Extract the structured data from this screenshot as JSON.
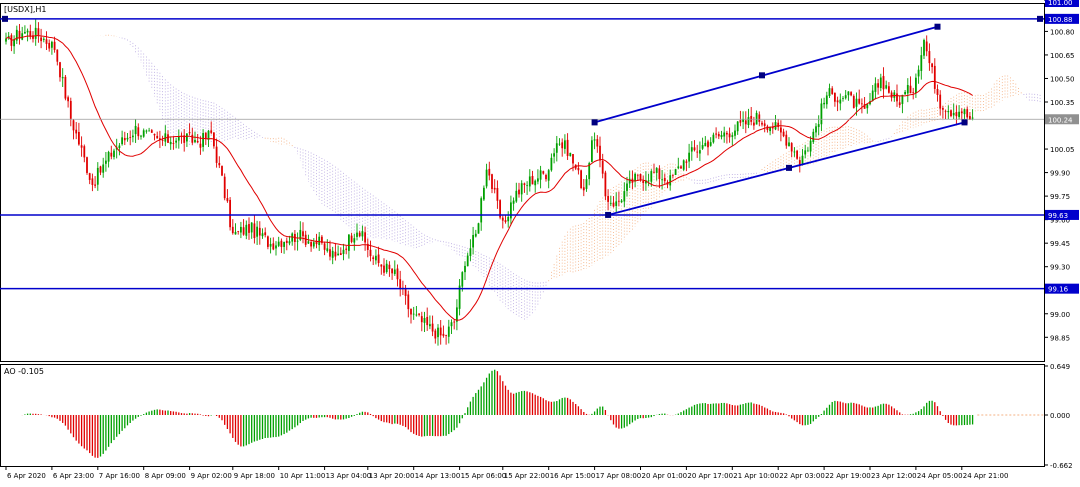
{
  "main_label": "[USDX],H1",
  "ao_label": "AO -0.105",
  "colors": {
    "bull": "#00a000",
    "bear": "#e00000",
    "ma": "#e00000",
    "trend": "#0000cc",
    "cloud_bull": "#f4b183",
    "cloud_bear": "#b8a8e0",
    "grid": "#c8c8c8",
    "price_line": "#9a9a9a"
  },
  "chart_data": [
    {
      "type": "line",
      "title": "[USDX],H1",
      "ylim": [
        98.75,
        101.05
      ],
      "yticks": [
        "101.00",
        "100.80",
        "100.65",
        "100.50",
        "100.35",
        "100.05",
        "99.90",
        "99.75",
        "99.60",
        "99.45",
        "99.30",
        "99.15",
        "99.00",
        "98.85"
      ],
      "y_tick_values": [
        101.0,
        100.8,
        100.65,
        100.5,
        100.35,
        100.05,
        99.9,
        99.75,
        99.6,
        99.45,
        99.3,
        99.15,
        99.0,
        98.85
      ],
      "x_tick_labels": [
        "6 Apr 2020",
        "6 Apr 23:00",
        "7 Apr 16:00",
        "8 Apr 09:00",
        "9 Apr 02:00",
        "9 Apr 18:00",
        "10 Apr 11:00",
        "13 Apr 04:00",
        "13 Apr 20:00",
        "14 Apr 13:00",
        "15 Apr 06:00",
        "15 Apr 22:00",
        "16 Apr 15:00",
        "17 Apr 08:00",
        "20 Apr 01:00",
        "20 Apr 17:00",
        "21 Apr 10:00",
        "22 Apr 03:00",
        "22 Apr 19:00",
        "23 Apr 12:00",
        "24 Apr 05:00",
        "24 Apr 21:00"
      ],
      "x_tick_bars": [
        0,
        17,
        34,
        51,
        68,
        84,
        101,
        118,
        134,
        151,
        168,
        184,
        201,
        218,
        235,
        252,
        269,
        286,
        303,
        320,
        337,
        354
      ],
      "bar_count": 359,
      "close_key_points": [
        [
          0,
          100.72
        ],
        [
          6,
          100.8
        ],
        [
          12,
          100.78
        ],
        [
          18,
          100.7
        ],
        [
          24,
          100.25
        ],
        [
          32,
          99.83
        ],
        [
          40,
          100.05
        ],
        [
          48,
          100.18
        ],
        [
          56,
          100.1
        ],
        [
          64,
          100.12
        ],
        [
          72,
          100.1
        ],
        [
          76,
          100.15
        ],
        [
          80,
          99.85
        ],
        [
          84,
          99.5
        ],
        [
          90,
          99.55
        ],
        [
          98,
          99.45
        ],
        [
          108,
          99.5
        ],
        [
          116,
          99.45
        ],
        [
          122,
          99.35
        ],
        [
          130,
          99.55
        ],
        [
          136,
          99.35
        ],
        [
          144,
          99.25
        ],
        [
          150,
          99.0
        ],
        [
          156,
          98.92
        ],
        [
          162,
          98.85
        ],
        [
          166,
          98.95
        ],
        [
          170,
          99.35
        ],
        [
          174,
          99.5
        ],
        [
          178,
          99.95
        ],
        [
          184,
          99.55
        ],
        [
          188,
          99.75
        ],
        [
          194,
          99.85
        ],
        [
          200,
          99.9
        ],
        [
          204,
          100.1
        ],
        [
          208,
          100.05
        ],
        [
          214,
          99.8
        ],
        [
          218,
          100.15
        ],
        [
          222,
          99.75
        ],
        [
          226,
          99.7
        ],
        [
          232,
          99.85
        ],
        [
          240,
          99.9
        ],
        [
          246,
          99.85
        ],
        [
          252,
          100.0
        ],
        [
          260,
          100.1
        ],
        [
          266,
          100.15
        ],
        [
          272,
          100.2
        ],
        [
          278,
          100.25
        ],
        [
          284,
          100.2
        ],
        [
          290,
          100.1
        ],
        [
          294,
          99.98
        ],
        [
          298,
          100.1
        ],
        [
          304,
          100.4
        ],
        [
          312,
          100.38
        ],
        [
          318,
          100.28
        ],
        [
          324,
          100.5
        ],
        [
          330,
          100.35
        ],
        [
          336,
          100.45
        ],
        [
          340,
          100.75
        ],
        [
          342,
          100.6
        ],
        [
          346,
          100.35
        ],
        [
          350,
          100.3
        ],
        [
          354,
          100.3
        ],
        [
          358,
          100.22
        ]
      ],
      "current_price": "100.24",
      "current_price_value": 100.24,
      "ma_period": 21,
      "levels": [
        {
          "name": "top-box",
          "label": "101.00",
          "value": 101.0
        },
        {
          "name": "resistance",
          "label": "100.88",
          "value": 100.88
        },
        {
          "name": "support",
          "label": "99.63",
          "value": 99.63
        },
        {
          "name": "lower-support",
          "label": "99.16",
          "value": 99.16
        }
      ],
      "channel": {
        "upper": {
          "start": [
            218,
            100.22
          ],
          "mid": [
            280,
            100.52
          ],
          "end": [
            345,
            100.83
          ]
        },
        "lower": {
          "start": [
            223,
            99.63
          ],
          "mid": [
            290,
            99.93
          ],
          "end": [
            355,
            100.22
          ]
        }
      }
    },
    {
      "type": "bar",
      "title": "AO -0.105",
      "series": [
        {
          "name": "AO",
          "value": -0.105
        }
      ],
      "ylim": [
        -0.662,
        0.649
      ],
      "yticks": [
        "0.649",
        "0.000",
        "-0.662"
      ],
      "y_tick_values": [
        0.649,
        0.0,
        -0.662
      ]
    }
  ]
}
